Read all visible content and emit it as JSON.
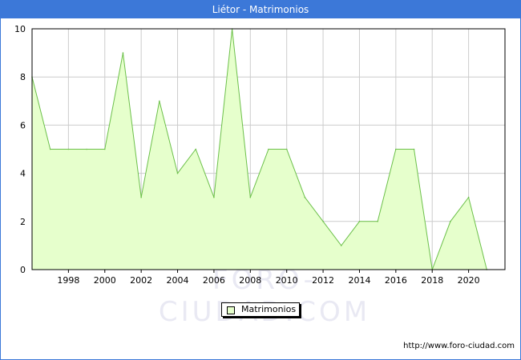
{
  "header": {
    "title": "Liétor - Matrimonios"
  },
  "footer": {
    "url": "http://www.foro-ciudad.com"
  },
  "watermark": "FORO-CIUDAD.COM",
  "colors": {
    "title_bar": "#3c78d8",
    "area_fill": "#e6ffcc",
    "area_line": "#6cc04a",
    "grid": "#cccccc"
  },
  "chart_data": {
    "type": "area",
    "title": "Liétor - Matrimonios",
    "xlabel": "",
    "ylabel": "",
    "x": [
      1996,
      1997,
      1998,
      1999,
      2000,
      2001,
      2002,
      2003,
      2004,
      2005,
      2006,
      2007,
      2008,
      2009,
      2010,
      2011,
      2012,
      2013,
      2014,
      2015,
      2016,
      2017,
      2018,
      2019,
      2020,
      2021
    ],
    "series": [
      {
        "name": "Matrimonios",
        "values": [
          8,
          5,
          5,
          5,
          5,
          9,
          3,
          7,
          4,
          5,
          3,
          10,
          3,
          5,
          5,
          3,
          2,
          1,
          2,
          2,
          5,
          5,
          0,
          2,
          3,
          0
        ]
      }
    ],
    "xlim": [
      1996,
      2022
    ],
    "ylim": [
      0,
      10
    ],
    "x_ticks": [
      "1998",
      "2000",
      "2002",
      "2004",
      "2006",
      "2008",
      "2010",
      "2012",
      "2014",
      "2016",
      "2018",
      "2020"
    ],
    "y_ticks": [
      "0",
      "2",
      "4",
      "6",
      "8",
      "10"
    ],
    "grid": true,
    "legend_position": "bottom-center"
  }
}
